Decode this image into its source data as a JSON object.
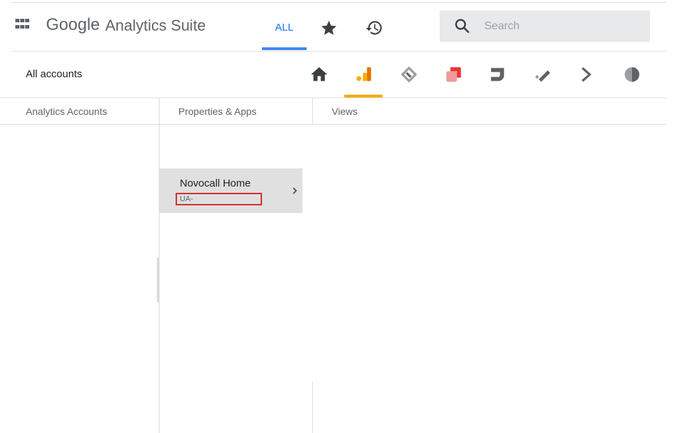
{
  "header": {
    "brand_google": "Google",
    "brand_product": "Analytics Suite",
    "tabs": {
      "all": "ALL"
    },
    "search": {
      "placeholder": "Search"
    }
  },
  "accounts_bar": {
    "title": "All accounts",
    "products": [
      {
        "name": "home-icon"
      },
      {
        "name": "analytics-icon",
        "selected": true,
        "color": "#f9ab00"
      },
      {
        "name": "tag-manager-icon"
      },
      {
        "name": "optimize-icon",
        "color": "#e57373"
      },
      {
        "name": "data-studio-icon"
      },
      {
        "name": "surveys-icon"
      },
      {
        "name": "attribution-icon"
      },
      {
        "name": "audience-center-icon"
      }
    ]
  },
  "columns": {
    "accounts_label": "Analytics Accounts",
    "properties_label": "Properties & Apps",
    "views_label": "Views"
  },
  "properties": [
    {
      "name": "Novocall Home",
      "id": "UA-"
    }
  ],
  "colors": {
    "accent_blue": "#1a73e8",
    "analytics_yellow": "#f9ab00",
    "highlight_red": "#d32f2f"
  }
}
